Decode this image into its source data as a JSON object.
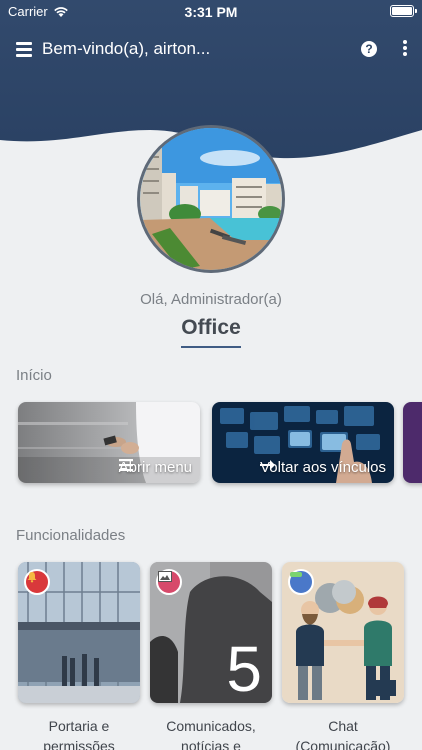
{
  "status_bar": {
    "carrier": "Carrier",
    "time": "3:31 PM"
  },
  "app_bar": {
    "title": "Bem-vindo(a), airton...",
    "help_glyph": "?"
  },
  "profile": {
    "greeting": "Olá, Administrador(a)",
    "name": "Office"
  },
  "sections": {
    "inicio": "Início",
    "funcionalidades": "Funcionalidades"
  },
  "inicio_cards": [
    {
      "label": "Abrir menu",
      "icon": "menu-icon"
    },
    {
      "label": "Voltar aos vínculos",
      "icon": "arrow-right-icon"
    }
  ],
  "func_cards": [
    {
      "label_line1": "Portaria e",
      "label_line2": "permissões",
      "badge_icon": "bell-icon",
      "badge_color": "#d9383b"
    },
    {
      "label_line1": "Comunicados,",
      "label_line2": "notícias e",
      "badge_icon": "image-icon",
      "badge_color": "#d74a6b",
      "count": "5"
    },
    {
      "label_line1": "Chat",
      "label_line2": "(Comunicação)",
      "badge_icon": "chat-icon",
      "badge_color": "#4a78c9"
    }
  ],
  "colors": {
    "header": "#2e4566",
    "background": "#eef0f2",
    "accent": "#3f5c84"
  }
}
